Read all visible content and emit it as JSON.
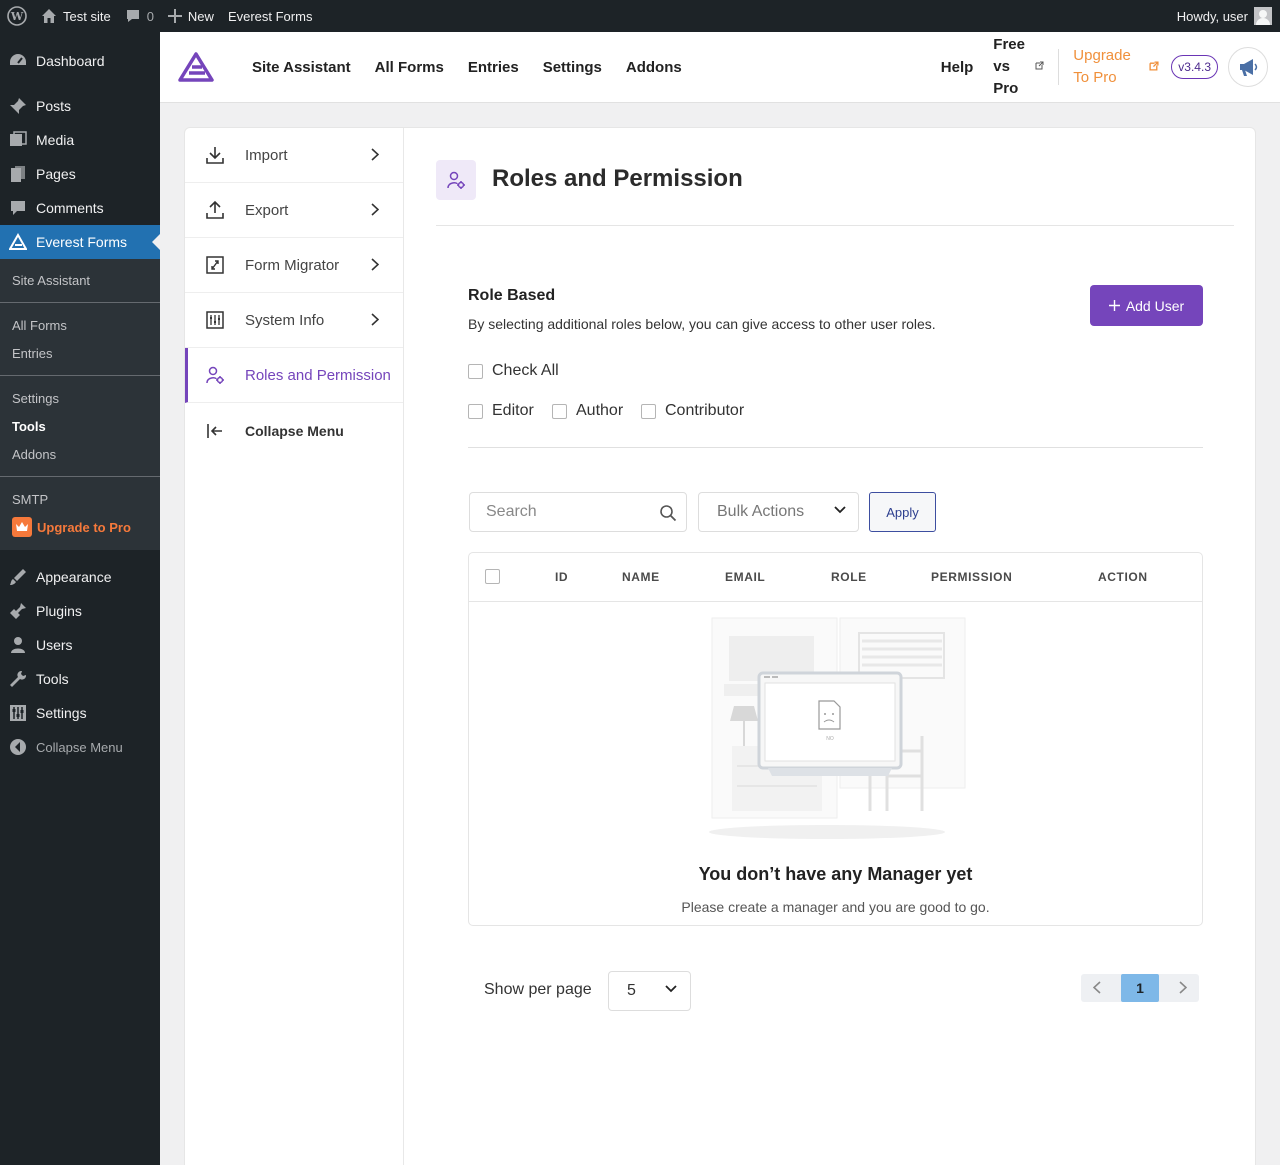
{
  "adminbar": {
    "site_name": "Test site",
    "comments_count": "0",
    "new_label": "New",
    "plugin_label": "Everest Forms",
    "howdy": "Howdy, user"
  },
  "sidebar": {
    "items": [
      {
        "label": "Dashboard",
        "icon": "dashboard-icon"
      },
      {
        "label": "Posts",
        "icon": "pin-icon"
      },
      {
        "label": "Media",
        "icon": "media-icon"
      },
      {
        "label": "Pages",
        "icon": "pages-icon"
      },
      {
        "label": "Comments",
        "icon": "comments-icon"
      },
      {
        "label": "Everest Forms",
        "icon": "everest-forms-icon"
      }
    ],
    "submenu": {
      "site_assistant": "Site Assistant",
      "all_forms": "All Forms",
      "entries": "Entries",
      "settings": "Settings",
      "tools": "Tools",
      "addons": "Addons",
      "smtp": "SMTP",
      "upgrade": "Upgrade to Pro"
    },
    "items_lower": [
      {
        "label": "Appearance",
        "icon": "appearance-icon"
      },
      {
        "label": "Plugins",
        "icon": "plugins-icon"
      },
      {
        "label": "Users",
        "icon": "users-icon"
      },
      {
        "label": "Tools",
        "icon": "tools-icon"
      },
      {
        "label": "Settings",
        "icon": "settings-icon"
      },
      {
        "label": "Collapse Menu",
        "icon": "collapse-icon"
      }
    ]
  },
  "header": {
    "nav": [
      "Site Assistant",
      "All Forms",
      "Entries",
      "Settings",
      "Addons"
    ],
    "help": "Help",
    "free_vs_pro": "Free vs Pro",
    "upgrade": "Upgrade To Pro",
    "version": "v3.4.3"
  },
  "tool_menu": {
    "items": [
      "Import",
      "Export",
      "Form Migrator",
      "System Info",
      "Roles and Permission"
    ],
    "collapse": "Collapse Menu"
  },
  "panel": {
    "title": "Roles and Permission",
    "role_title": "Role Based",
    "role_desc": "By selecting additional roles below, you can give access to other user roles.",
    "add_user": "Add User",
    "check_all": "Check All",
    "roles": [
      "Editor",
      "Author",
      "Contributor"
    ],
    "search_placeholder": "Search",
    "bulk_actions": "Bulk Actions",
    "apply": "Apply",
    "columns": [
      "ID",
      "NAME",
      "EMAIL",
      "ROLE",
      "PERMISSION",
      "ACTION"
    ],
    "empty_title": "You don’t have any Manager yet",
    "empty_sub": "Please create a manager and you are good to go.",
    "per_page_label": "Show per page",
    "per_page_value": "5",
    "current_page": "1"
  },
  "colors": {
    "accent": "#7545bb",
    "wp_active": "#2271b1",
    "upgrade": "#f0903b"
  }
}
